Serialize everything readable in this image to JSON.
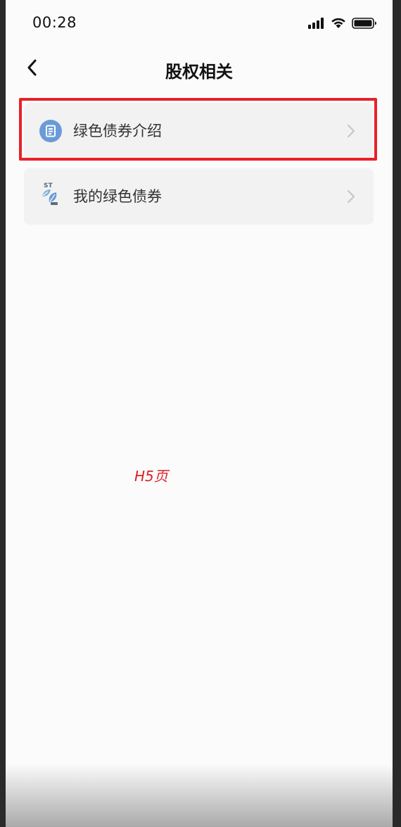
{
  "status_bar": {
    "time": "00:28",
    "icons": [
      "signal-icon",
      "wifi-icon",
      "battery-icon"
    ]
  },
  "nav": {
    "back_icon": "chevron-left-icon",
    "title": "股权相关"
  },
  "menu": {
    "items": [
      {
        "label": "绿色债券介绍",
        "icon": "document-icon",
        "highlighted": true
      },
      {
        "label": "我的绿色债券",
        "icon": "st-leaf-icon",
        "highlighted": false
      }
    ]
  },
  "annotation": {
    "text": "H5页",
    "color": "#e01c24"
  },
  "colors": {
    "page_background": "#fbfbfb",
    "item_background": "#f2f2f2",
    "highlight_border": "#e8202a",
    "icon_blue": "#6a9bd6"
  }
}
